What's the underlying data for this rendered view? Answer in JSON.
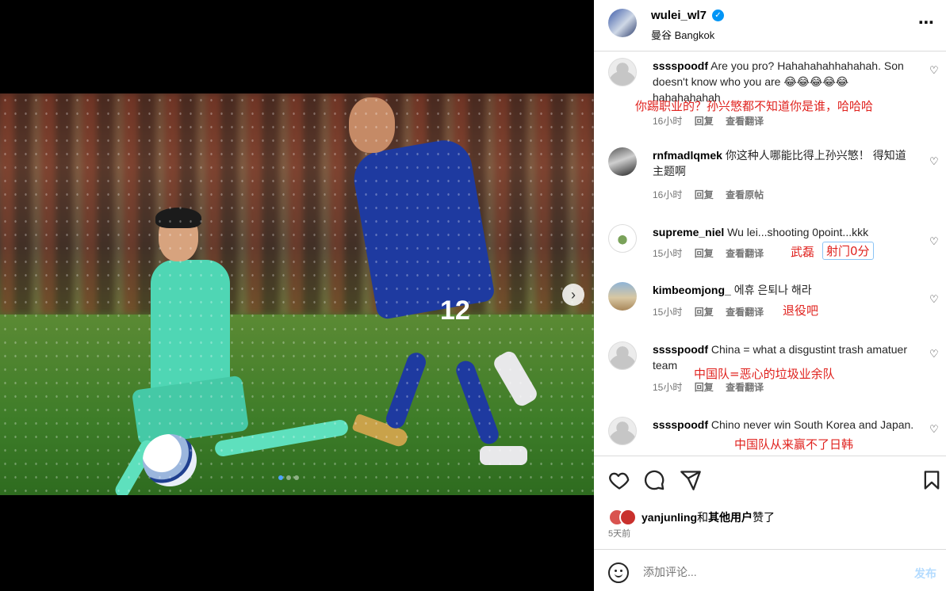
{
  "post": {
    "username": "wulei_wl7",
    "location": "曼谷 Bangkok",
    "more_icon": "⋯",
    "verified_icon": "✓",
    "jersey_number": "12"
  },
  "carousel": {
    "next_icon": "›",
    "dot_count": 3,
    "active_dot": 0
  },
  "comments": [
    {
      "user": "sssspoodf",
      "text": "Are you pro? Hahahahahhahahah. Son doesn't know who you are 😂😂😂😂😂 hahahahahah",
      "time": "16小时",
      "reply": "回复",
      "translate": "查看翻译",
      "annotation": "你踢职业的？孙兴慜都不知道你是谁，哈哈哈"
    },
    {
      "user": "rnfmadlqmek",
      "text": "你这种人哪能比得上孙兴慜！ 得知道主题啊",
      "time": "16小时",
      "reply": "回复",
      "translate": "查看原帖",
      "annotation": ""
    },
    {
      "user": "supreme_niel",
      "text": "Wu lei...shooting 0point...kkk",
      "time": "15小时",
      "reply": "回复",
      "translate": "查看翻译",
      "annotation_a": "武磊",
      "annotation_b": "射门0分"
    },
    {
      "user": "kimbeomjong_",
      "text": "에휴 은퇴나 해라",
      "time": "15小时",
      "reply": "回复",
      "translate": "查看翻译",
      "annotation": "退役吧"
    },
    {
      "user": "sssspoodf",
      "text": "China = what a disgustint trash amatuer team",
      "time": "15小时",
      "reply": "回复",
      "translate": "查看翻译",
      "annotation": "中国队=恶心的垃圾业余队"
    },
    {
      "user": "sssspoodf",
      "text": "Chino never win South Korea and Japan.",
      "annotation": "中国队从来赢不了日韩"
    }
  ],
  "likes": {
    "user": "yanjunling",
    "joiner": "和",
    "others": "其他用户",
    "suffix": "赞了"
  },
  "date": "5天前",
  "add_comment": {
    "placeholder": "添加评论...",
    "post_label": "发布"
  },
  "colors": {
    "accent": "#0095f6",
    "annotation": "#e0221e",
    "post_disabled": "#b3dbff"
  }
}
